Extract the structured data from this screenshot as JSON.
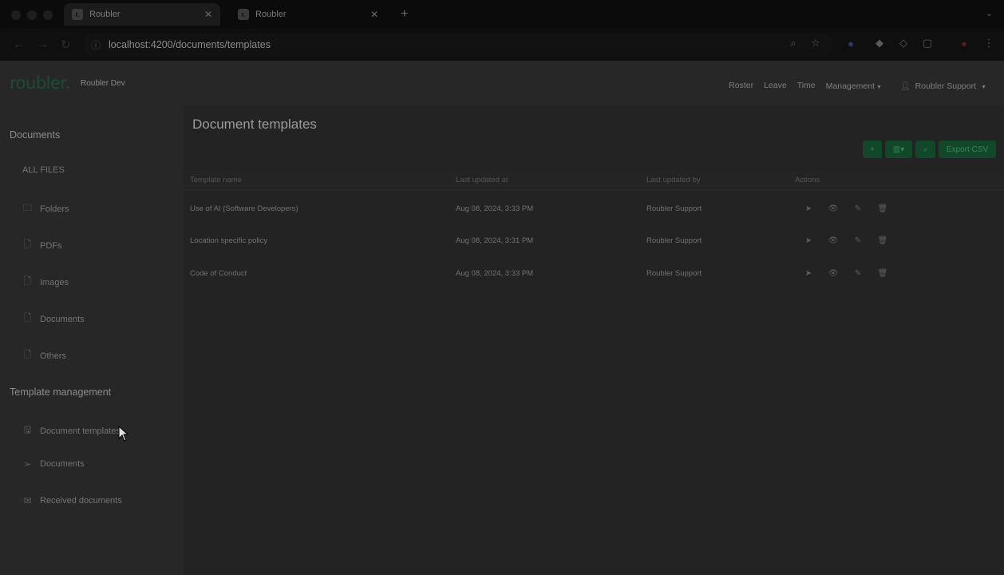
{
  "browser": {
    "tabs": [
      {
        "title": "Roubler",
        "favicon": "r.",
        "active": true
      },
      {
        "title": "Roubler",
        "favicon": "r.",
        "active": false
      }
    ],
    "url": "localhost:4200/documents/templates"
  },
  "app": {
    "logo": "roubler.",
    "org_name": "Roubler Dev",
    "nav": {
      "roster": "Roster",
      "leave": "Leave",
      "time": "Time",
      "management": "Management",
      "user": "Roubler Support"
    }
  },
  "sidebar": {
    "documents_heading": "Documents",
    "all_files": "ALL FILES",
    "file_items": [
      {
        "label": "Folders",
        "icon": "folder-icon"
      },
      {
        "label": "PDFs",
        "icon": "file-icon"
      },
      {
        "label": "Images",
        "icon": "file-icon"
      },
      {
        "label": "Documents",
        "icon": "file-icon"
      },
      {
        "label": "Others",
        "icon": "file-icon"
      }
    ],
    "template_heading": "Template management",
    "template_items": [
      {
        "label": "Document templates",
        "icon": "save-icon"
      },
      {
        "label": "Documents",
        "icon": "send-icon"
      },
      {
        "label": "Received documents",
        "icon": "inbox-icon"
      }
    ]
  },
  "main": {
    "title": "Document templates",
    "toolbar": {
      "add": "+",
      "columns": "▥▾",
      "search": "⌕",
      "export": "Export CSV"
    },
    "columns": [
      "Template name",
      "Last updated at",
      "Last updated by",
      "Actions"
    ],
    "rows": [
      {
        "name": "Use of AI (Software Developers)",
        "updated_at": "Aug 08, 2024, 3:33 PM",
        "updated_by": "Roubler Support"
      },
      {
        "name": "Location specific policy",
        "updated_at": "Aug 08, 2024, 3:31 PM",
        "updated_by": "Roubler Support"
      },
      {
        "name": "Code of Conduct",
        "updated_at": "Aug 08, 2024, 3:33 PM",
        "updated_by": "Roubler Support"
      }
    ]
  },
  "colors": {
    "brand_green": "#12472a",
    "overlay_dark": "#262626"
  }
}
